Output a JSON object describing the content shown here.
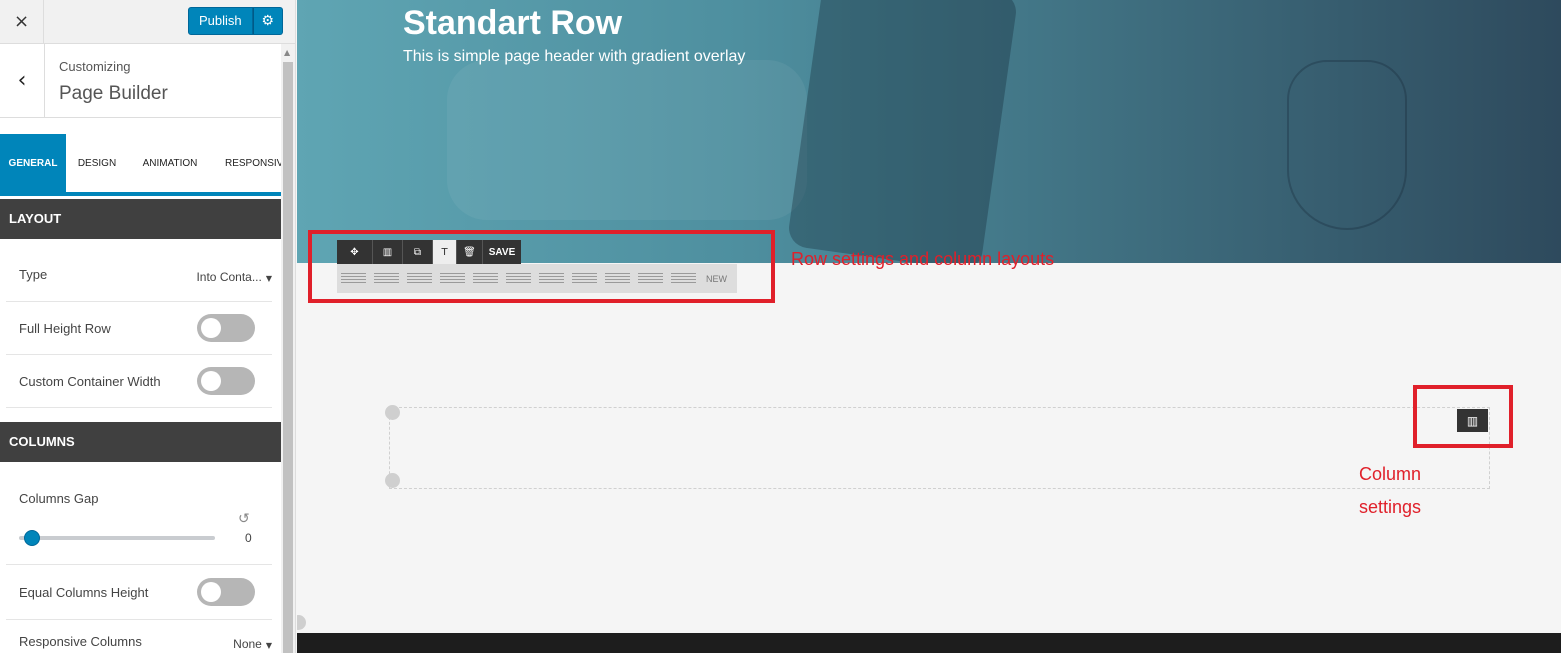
{
  "sidebar": {
    "close_icon": "×",
    "publish_label": "Publish",
    "settings_icon": "⚙",
    "back_icon": "‹",
    "customizing_label": "Customizing",
    "section_title": "Page Builder",
    "tabs": [
      {
        "label": "GENERAL",
        "active": true
      },
      {
        "label": "DESIGN",
        "active": false
      },
      {
        "label": "ANIMATION",
        "active": false
      },
      {
        "label": "RESPONSIV",
        "active": false
      }
    ],
    "layout": {
      "heading": "LAYOUT",
      "type_label": "Type",
      "type_value": "Into Conta...",
      "full_height_label": "Full Height Row",
      "full_height_on": false,
      "custom_width_label": "Custom Container Width",
      "custom_width_on": false
    },
    "columns": {
      "heading": "COLUMNS",
      "gap_label": "Columns Gap",
      "gap_value": "0",
      "equal_height_label": "Equal Columns Height",
      "equal_height_on": false,
      "responsive_label": "Responsive Columns",
      "responsive_value": "None"
    }
  },
  "preview": {
    "hero_title": "Standart Row",
    "hero_subtitle": "This is simple page header with gradient overlay",
    "toolbar": {
      "move_icon": "✥",
      "columns_icon": "▥",
      "copy_icon": "⧉",
      "text_icon": "T",
      "delete_icon": "🗑",
      "save_label": "SAVE"
    },
    "layout_new_label": "NEW",
    "column_settings_icon": "▥",
    "annotations": {
      "row_note": "Row settings and column layouts",
      "column_note_line1": "Column",
      "column_note_line2": "settings"
    },
    "accent_red": "#e0202a",
    "accent_blue": "#0085ba"
  }
}
